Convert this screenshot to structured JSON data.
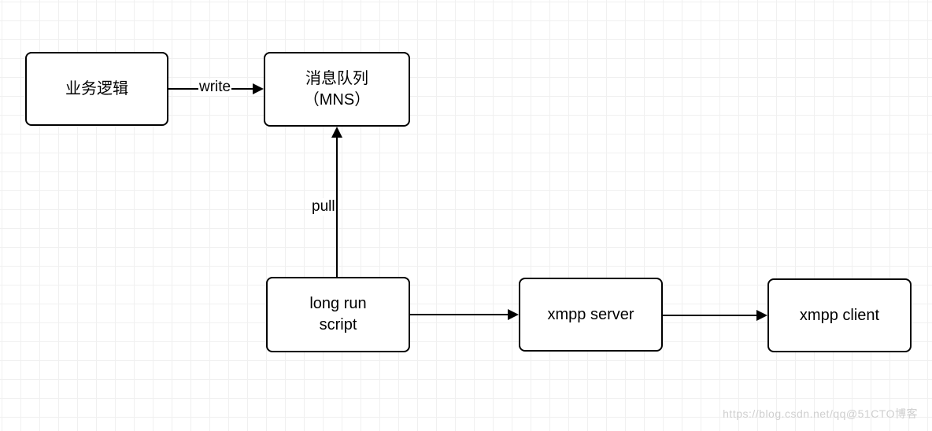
{
  "nodes": {
    "business_logic": {
      "label": "业务逻辑"
    },
    "message_queue": {
      "line1": "消息队列",
      "line2": "（MNS）"
    },
    "long_run_script": {
      "line1": "long run",
      "line2": "script"
    },
    "xmpp_server": {
      "label": "xmpp server"
    },
    "xmpp_client": {
      "label": "xmpp client"
    }
  },
  "edges": {
    "write": {
      "label": "write"
    },
    "pull": {
      "label": "pull"
    }
  },
  "watermark": "https://blog.csdn.net/qq@51CTO博客"
}
